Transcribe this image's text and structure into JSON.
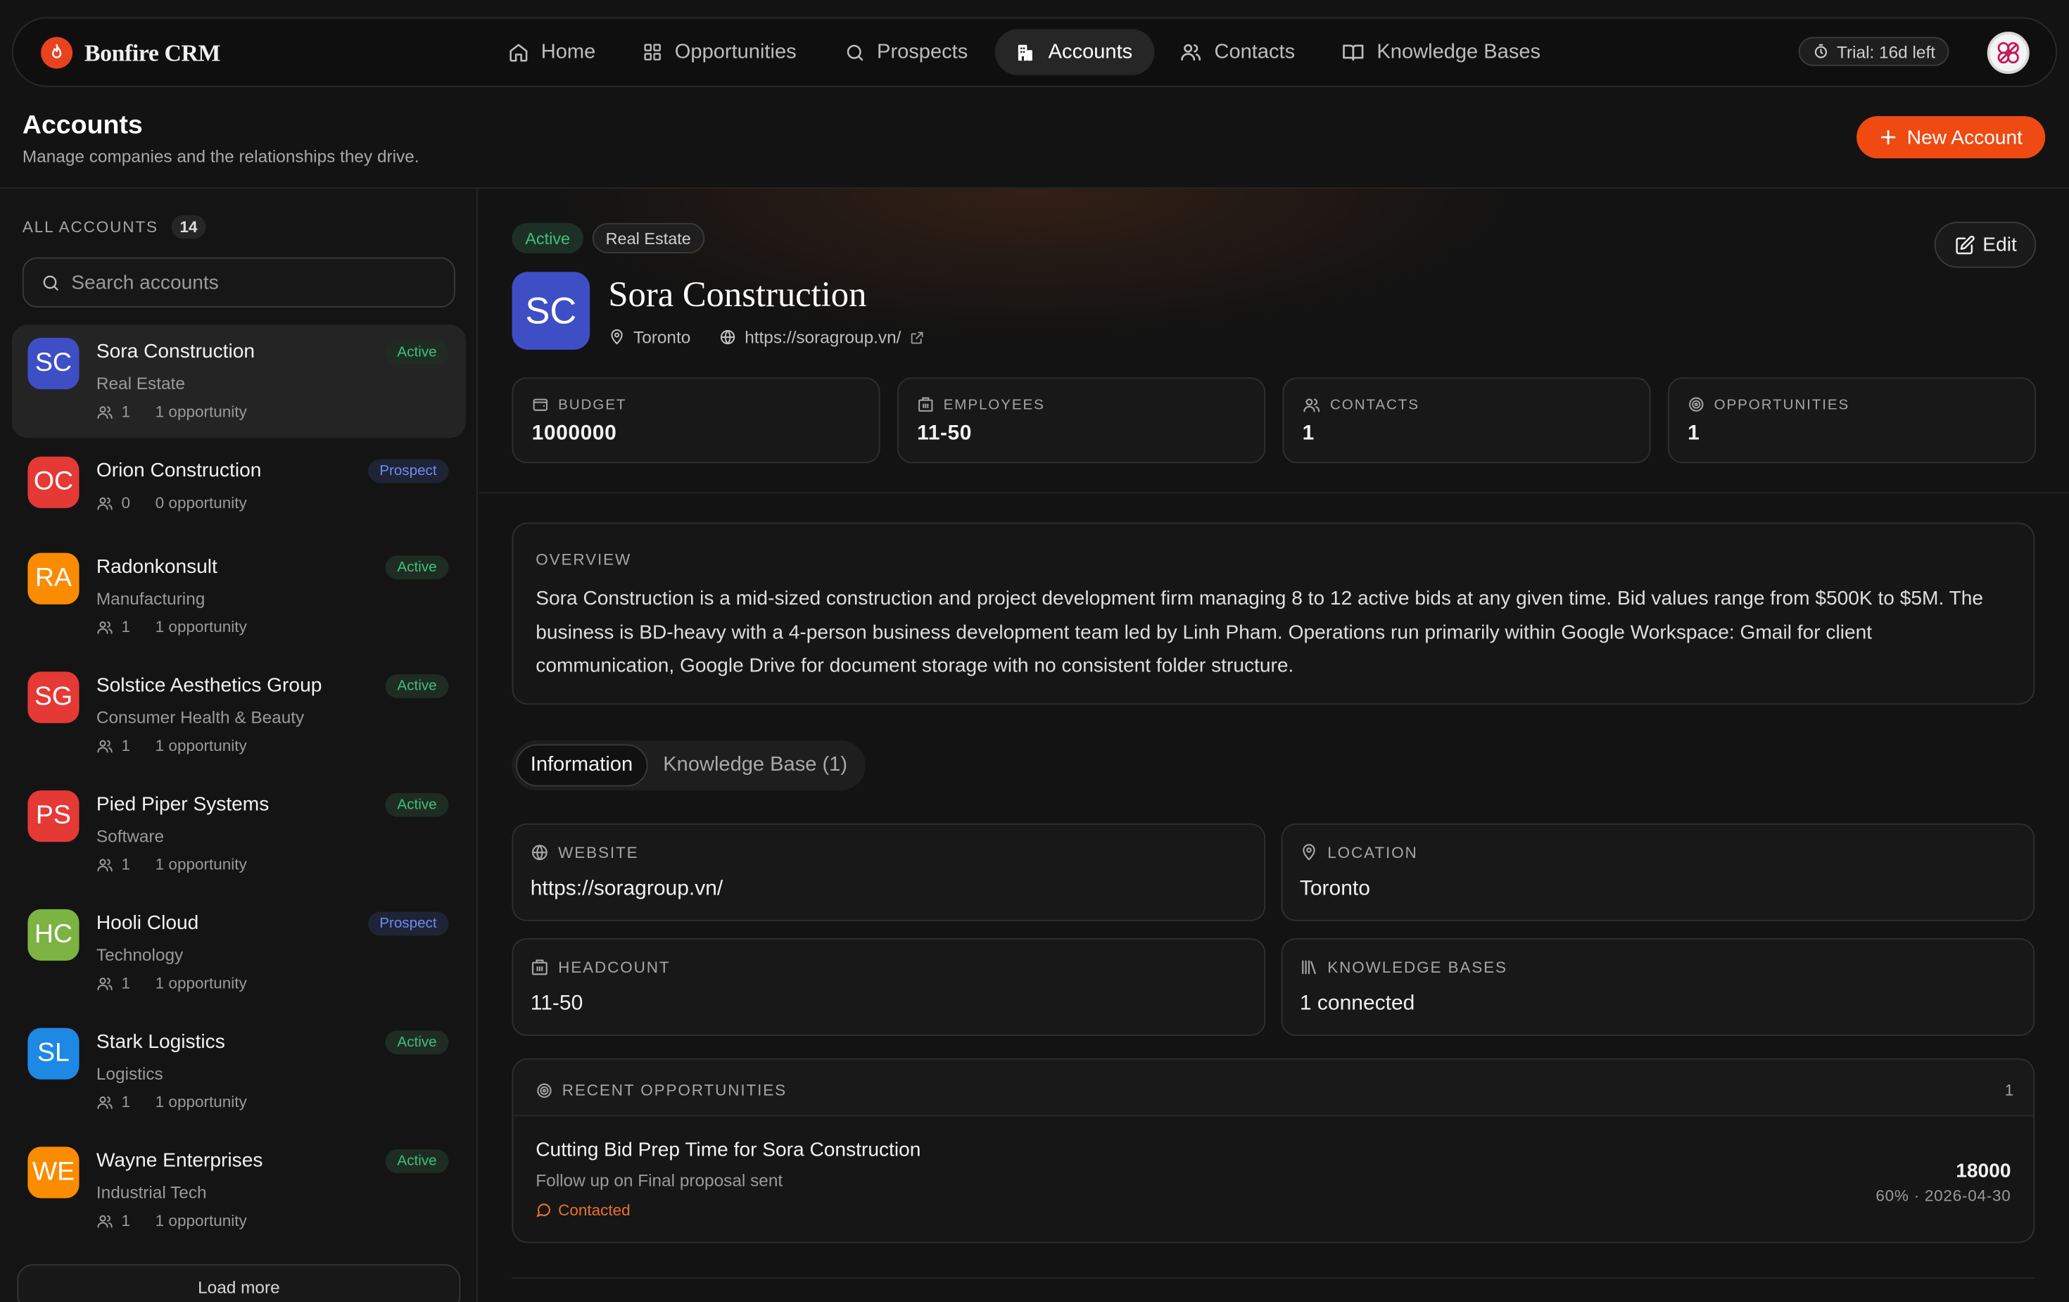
{
  "app": {
    "name": "Bonfire CRM"
  },
  "nav": {
    "items": [
      {
        "label": "Home",
        "icon": "home-icon"
      },
      {
        "label": "Opportunities",
        "icon": "grid-icon"
      },
      {
        "label": "Prospects",
        "icon": "search-icon"
      },
      {
        "label": "Accounts",
        "icon": "building-icon",
        "active": true
      },
      {
        "label": "Contacts",
        "icon": "users-icon"
      },
      {
        "label": "Knowledge Bases",
        "icon": "book-icon"
      }
    ],
    "trial": "Trial: 16d left"
  },
  "header": {
    "title": "Accounts",
    "subtitle": "Manage companies and the relationships they drive.",
    "new_button": "New Account"
  },
  "sidebar": {
    "heading": "ALL ACCOUNTS",
    "count": "14",
    "search_placeholder": "Search accounts",
    "accounts": [
      {
        "initials": "SC",
        "name": "Sora Construction",
        "industry": "Real Estate",
        "contacts": "1",
        "opportunities": "1 opportunity",
        "status": "Active",
        "color": "#3e4fc6"
      },
      {
        "initials": "OC",
        "name": "Orion Construction",
        "industry": "",
        "contacts": "0",
        "opportunities": "0 opportunity",
        "status": "Prospect",
        "color": "#e53935"
      },
      {
        "initials": "RA",
        "name": "Radonkonsult",
        "industry": "Manufacturing",
        "contacts": "1",
        "opportunities": "1 opportunity",
        "status": "Active",
        "color": "#fb8c00"
      },
      {
        "initials": "SG",
        "name": "Solstice Aesthetics Group",
        "industry": "Consumer Health & Beauty",
        "contacts": "1",
        "opportunities": "1 opportunity",
        "status": "Active",
        "color": "#e53935"
      },
      {
        "initials": "PS",
        "name": "Pied Piper Systems",
        "industry": "Software",
        "contacts": "1",
        "opportunities": "1 opportunity",
        "status": "Active",
        "color": "#e53935"
      },
      {
        "initials": "HC",
        "name": "Hooli Cloud",
        "industry": "Technology",
        "contacts": "1",
        "opportunities": "1 opportunity",
        "status": "Prospect",
        "color": "#7cb342"
      },
      {
        "initials": "SL",
        "name": "Stark Logistics",
        "industry": "Logistics",
        "contacts": "1",
        "opportunities": "1 opportunity",
        "status": "Active",
        "color": "#1e88e5"
      },
      {
        "initials": "WE",
        "name": "Wayne Enterprises",
        "industry": "Industrial Tech",
        "contacts": "1",
        "opportunities": "1 opportunity",
        "status": "Active",
        "color": "#fb8c00"
      }
    ],
    "load_more": "Load more"
  },
  "detail": {
    "status": "Active",
    "category": "Real Estate",
    "edit": "Edit",
    "initials": "SC",
    "name": "Sora Construction",
    "location": "Toronto",
    "website": "https://soragroup.vn/",
    "stats": [
      {
        "label": "BUDGET",
        "value": "1000000",
        "icon": "wallet-icon"
      },
      {
        "label": "EMPLOYEES",
        "value": "11-50",
        "icon": "building-icon"
      },
      {
        "label": "CONTACTS",
        "value": "1",
        "icon": "users-icon"
      },
      {
        "label": "OPPORTUNITIES",
        "value": "1",
        "icon": "target-icon"
      }
    ],
    "overview_label": "OVERVIEW",
    "overview": "Sora Construction is a mid-sized construction and project development firm managing 8 to 12 active bids at any given time. Bid values range from $500K to $5M. The business is BD-heavy with a 4-person business development team led by Linh Pham. Operations run primarily within Google Workspace: Gmail for client communication, Google Drive for document storage with no consistent folder structure.",
    "tabs": [
      {
        "label": "Information",
        "active": true
      },
      {
        "label": "Knowledge Base (1)"
      }
    ],
    "info": [
      {
        "label": "WEBSITE",
        "value": "https://soragroup.vn/",
        "icon": "globe-icon"
      },
      {
        "label": "LOCATION",
        "value": "Toronto",
        "icon": "map-pin-icon"
      },
      {
        "label": "HEADCOUNT",
        "value": "11-50",
        "icon": "building-icon"
      },
      {
        "label": "KNOWLEDGE BASES",
        "value": "1 connected",
        "icon": "library-icon"
      }
    ],
    "recent": {
      "label": "RECENT OPPORTUNITIES",
      "count": "1",
      "item": {
        "title": "Cutting Bid Prep Time for Sora Construction",
        "subtitle": "Follow up on Final proposal sent",
        "status": "Contacted",
        "amount": "18000",
        "meta": "60% · 2026-04-30"
      }
    }
  }
}
